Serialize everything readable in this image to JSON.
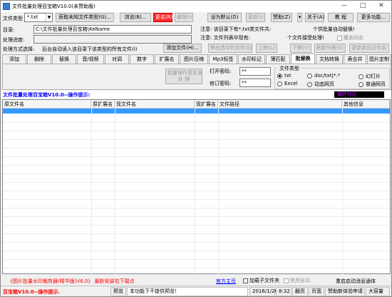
{
  "window": {
    "title": "文件批量处理百宝箱V10.0(未赞助版)",
    "minimize": "—",
    "maximize": "□",
    "close": "✕"
  },
  "toolbar": {
    "file_type_label": "文件类型",
    "file_type_value": "*.txt",
    "get_unknown_btn": "获取未知文件类型(G)...",
    "browse_btn": "浏览(B)...",
    "rename_btn": "更名(R)",
    "undo_btn": "撤销(I)",
    "set_default_btn": "设为默认(D)",
    "update_btn": "更新(U)",
    "sponsor_btn": "赞助(Z)",
    "about_btn": "关于(A)",
    "tutorial_btn": "教 程",
    "more_btn": "更多功能..."
  },
  "info": {
    "dir_label": "目录:",
    "dir_value": "C:\\文件批量处理百宝箱\\KeName",
    "progress_label": "处理进度:",
    "note1": "注意: 该目录下有*.txt类文件共:",
    "note2": "注意: 文件列表中现有:",
    "batch_auto": "个供批量自动替换!",
    "pending": "个文件接受处理!",
    "overwrite_chk": "覆盖同名",
    "method_label": "处理方式选择:",
    "auto_read_chk": "后台自动读入该目录下该类型的所有文件(I)",
    "add_file_btn": "添加文件(H)...",
    "remove_btn": "移出选中的文件(E)",
    "up_btn": "上移(L)",
    "down_btn": "下移(V)",
    "refresh_btn": "刷新列表(S)",
    "restore_btn": "更新新旧文件名"
  },
  "tabs": [
    "添加",
    "删除",
    "替换",
    "音/视频",
    "对调",
    "数字",
    "扩展名",
    "图片压缩",
    "Mp3标签",
    "水印标记",
    "薄匹配",
    "批替换",
    "文档转换",
    "表合并",
    "图片定制"
  ],
  "panel": {
    "batch_btn_line1": "批量操作意反发",
    "batch_btn_line2": "处 理",
    "open_pwd_label": "打开密码:",
    "open_pwd_value": "**",
    "modify_pwd_label": "修订密码:",
    "modify_pwd_value": "**",
    "doc_type_group": "文件类型",
    "types": [
      "txt",
      "doc/txt|*.*",
      "幻灯片",
      "Excel",
      "动态网页",
      "普通网页"
    ]
  },
  "statusline": {
    "text": "文件批量处理百宝箱V10.0--操作提示:",
    "badge": "编外社区"
  },
  "grid": {
    "columns": [
      "原文件名",
      "原扩展名",
      "现文件名",
      "现扩展名",
      "文件路径",
      "其他信息"
    ]
  },
  "footer": {
    "ad_text": "《图片批量水印裁剪器(精华版)V6.0》 最新安装包下载点",
    "website": "官方主页",
    "load_sub_chk": "加载子文件夹",
    "disable_chk": "禁用自动",
    "restart_text": "重启启动消息通体",
    "status_text": "百宝箱V10.0--操作提示.",
    "preview_label": "预览",
    "preview_msg": "本功能下不提供预览!",
    "date": "2016/1/26",
    "time": "8:32",
    "pages_label": "翻页",
    "ucs_label": "页宽",
    "sponsor_apply": "赞助新体验申请",
    "font_size": "大容量"
  }
}
